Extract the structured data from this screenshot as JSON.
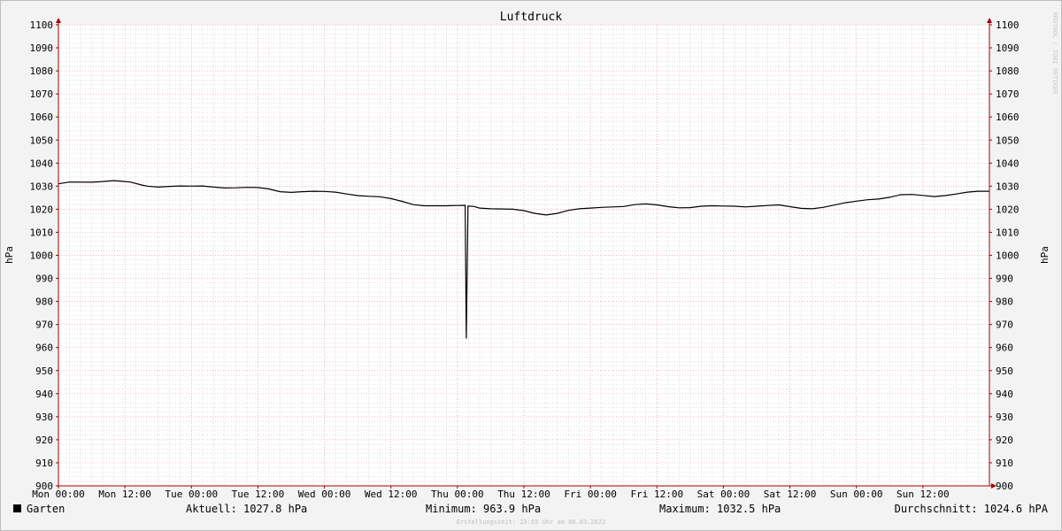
{
  "chart_data": {
    "type": "line",
    "title": "Luftdruck",
    "ylabel": "hPa",
    "ylim": [
      900,
      1100
    ],
    "yticks": [
      900,
      910,
      920,
      930,
      940,
      950,
      960,
      970,
      980,
      990,
      1000,
      1010,
      1020,
      1030,
      1040,
      1050,
      1060,
      1070,
      1080,
      1090,
      1100
    ],
    "xlim": [
      0,
      168
    ],
    "xticks": [
      {
        "x": 0,
        "label": "Mon 00:00"
      },
      {
        "x": 12,
        "label": "Mon 12:00"
      },
      {
        "x": 24,
        "label": "Tue 00:00"
      },
      {
        "x": 36,
        "label": "Tue 12:00"
      },
      {
        "x": 48,
        "label": "Wed 00:00"
      },
      {
        "x": 60,
        "label": "Wed 12:00"
      },
      {
        "x": 72,
        "label": "Thu 00:00"
      },
      {
        "x": 84,
        "label": "Thu 12:00"
      },
      {
        "x": 96,
        "label": "Fri 00:00"
      },
      {
        "x": 108,
        "label": "Fri 12:00"
      },
      {
        "x": 120,
        "label": "Sat 00:00"
      },
      {
        "x": 132,
        "label": "Sat 12:00"
      },
      {
        "x": 144,
        "label": "Sun 00:00"
      },
      {
        "x": 156,
        "label": "Sun 12:00"
      }
    ],
    "grid": true,
    "series": [
      {
        "name": "Garten",
        "color": "#000000",
        "points": [
          [
            0,
            1031.0
          ],
          [
            2,
            1031.8
          ],
          [
            6,
            1031.7
          ],
          [
            8,
            1032.0
          ],
          [
            10,
            1032.4
          ],
          [
            12,
            1032.0
          ],
          [
            13,
            1031.8
          ],
          [
            15,
            1030.5
          ],
          [
            16,
            1030.0
          ],
          [
            18,
            1029.6
          ],
          [
            20,
            1029.9
          ],
          [
            22,
            1030.1
          ],
          [
            24,
            1030.0
          ],
          [
            26,
            1030.1
          ],
          [
            28,
            1029.6
          ],
          [
            30,
            1029.2
          ],
          [
            32,
            1029.3
          ],
          [
            34,
            1029.5
          ],
          [
            36,
            1029.4
          ],
          [
            38,
            1028.8
          ],
          [
            40,
            1027.6
          ],
          [
            42,
            1027.3
          ],
          [
            44,
            1027.6
          ],
          [
            46,
            1027.8
          ],
          [
            48,
            1027.7
          ],
          [
            50,
            1027.4
          ],
          [
            52,
            1026.6
          ],
          [
            54,
            1025.9
          ],
          [
            56,
            1025.6
          ],
          [
            58,
            1025.4
          ],
          [
            60,
            1024.6
          ],
          [
            62,
            1023.4
          ],
          [
            64,
            1022.0
          ],
          [
            66,
            1021.5
          ],
          [
            68,
            1021.5
          ],
          [
            70,
            1021.5
          ],
          [
            72,
            1021.6
          ],
          [
            73.4,
            1021.7
          ],
          [
            73.6,
            963.9
          ],
          [
            73.9,
            1021.4
          ],
          [
            75,
            1021.2
          ],
          [
            76,
            1020.5
          ],
          [
            78,
            1020.2
          ],
          [
            80,
            1020.1
          ],
          [
            82,
            1020.0
          ],
          [
            84,
            1019.4
          ],
          [
            86,
            1018.2
          ],
          [
            88,
            1017.5
          ],
          [
            90,
            1018.2
          ],
          [
            92,
            1019.5
          ],
          [
            94,
            1020.2
          ],
          [
            96,
            1020.5
          ],
          [
            98,
            1020.8
          ],
          [
            100,
            1021.0
          ],
          [
            102,
            1021.2
          ],
          [
            104,
            1022.0
          ],
          [
            106,
            1022.3
          ],
          [
            108,
            1021.9
          ],
          [
            110,
            1021.1
          ],
          [
            112,
            1020.6
          ],
          [
            114,
            1020.7
          ],
          [
            116,
            1021.3
          ],
          [
            118,
            1021.5
          ],
          [
            120,
            1021.4
          ],
          [
            122,
            1021.3
          ],
          [
            124,
            1021.0
          ],
          [
            126,
            1021.3
          ],
          [
            128,
            1021.6
          ],
          [
            130,
            1021.9
          ],
          [
            132,
            1021.1
          ],
          [
            134,
            1020.4
          ],
          [
            136,
            1020.2
          ],
          [
            138,
            1020.8
          ],
          [
            140,
            1021.8
          ],
          [
            142,
            1022.8
          ],
          [
            144,
            1023.5
          ],
          [
            146,
            1024.1
          ],
          [
            148,
            1024.4
          ],
          [
            150,
            1025.2
          ],
          [
            152,
            1026.3
          ],
          [
            154,
            1026.4
          ],
          [
            156,
            1026.0
          ],
          [
            158,
            1025.5
          ],
          [
            160,
            1025.9
          ],
          [
            162,
            1026.6
          ],
          [
            164,
            1027.4
          ],
          [
            166,
            1027.8
          ],
          [
            168,
            1027.8
          ]
        ]
      }
    ]
  },
  "legend": {
    "series_name": "Garten",
    "aktuell": "Aktuell: 1027.8 hPa",
    "minimum": "Minimum: 963.9 hPa",
    "maximum": "Maximum: 1032.5 hPa",
    "durchschnitt": "Durchschnitt: 1024.6 hPA"
  },
  "footer": {
    "created": "Erstellungszeit: 23:55 Uhr am 06.03.2022",
    "watermark": "RRDTOOL / TOBI OETIKER"
  },
  "colors": {
    "background": "#f3f3f3",
    "canvas": "#ffffff",
    "major_grid": "#e8a0a0",
    "minor_grid": "#cccccc",
    "axis": "#aa0000",
    "line": "#000000"
  }
}
